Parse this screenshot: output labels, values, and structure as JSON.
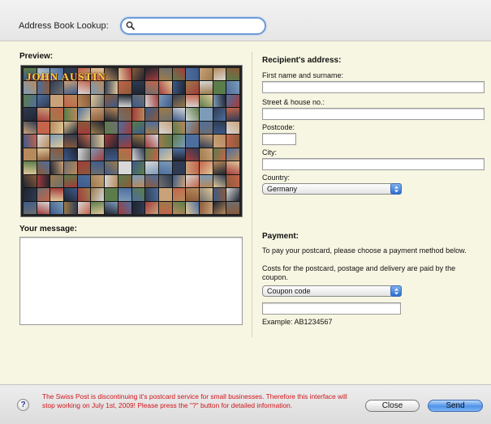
{
  "header": {
    "lookup_label": "Address Book Lookup:",
    "search_value": "",
    "search_icon": "magnifier-icon"
  },
  "preview": {
    "heading": "Preview:",
    "image_title": "JOHN AUSTIN"
  },
  "message": {
    "heading": "Your message:",
    "value": ""
  },
  "recipient": {
    "heading": "Recipient's address:",
    "name_label": "First name and surname:",
    "name_value": "",
    "street_label": "Street & house no.:",
    "street_value": "",
    "postcode_label": "Postcode:",
    "postcode_value": "",
    "city_label": "City:",
    "city_value": "",
    "country_label": "Country:",
    "country_selected": "Germany"
  },
  "payment": {
    "heading": "Payment:",
    "description_1": "To pay your postcard, please choose a payment method below.",
    "description_2": "Costs for the postcard, postage and delivery are paid by the coupon.",
    "method_selected": "Coupon code",
    "code_value": "",
    "example": "Example: AB1234567"
  },
  "footer": {
    "help_symbol": "?",
    "notice": "The Swiss Post is discontinuing it's postcard service for small businesses. Therefore this interface will stop working on July 1st, 2009! Please press the \"?\" button for detailed information.",
    "close_label": "Close",
    "send_label": "Send"
  },
  "colors": {
    "panel_background": "#f7f6e2",
    "notice_text": "#d2141b",
    "accent_blue": "#4f93ea"
  }
}
